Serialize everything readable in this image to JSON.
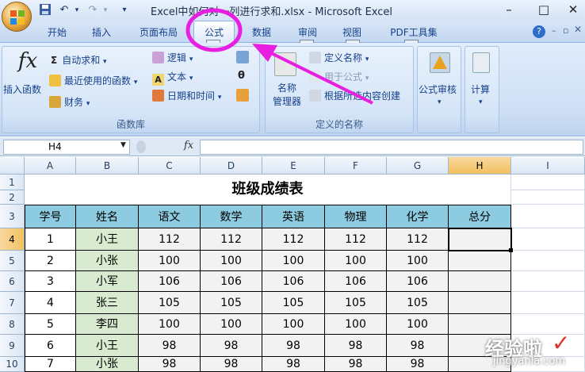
{
  "window": {
    "title": "Excel中如何对一列进行求和.xlsx - Microsoft Excel",
    "minimize": "–",
    "restore": "□",
    "close": "✕"
  },
  "quick_access": {
    "save": "save-icon",
    "undo": "undo-icon",
    "redo": "redo-icon",
    "customize": "customize-icon"
  },
  "tabs": [
    {
      "label": "开始"
    },
    {
      "label": "插入"
    },
    {
      "label": "页面布局"
    },
    {
      "label": "公式",
      "keytip": "M",
      "active": true
    },
    {
      "label": "数据",
      "keytip": "R"
    },
    {
      "label": "审阅",
      "keytip": "W"
    },
    {
      "label": "视图",
      "keytip": "Y"
    },
    {
      "label": "PDF工具集"
    }
  ],
  "ribbon": {
    "function_library": {
      "label": "函数库",
      "insert_function": "插入函数",
      "autosum": "自动求和",
      "recent": "最近使用的函数",
      "financial": "财务",
      "logical": "逻辑",
      "text": "文本",
      "datetime": "日期和时间"
    },
    "defined_names": {
      "label": "定义的名称",
      "name_manager": "名称管理器",
      "name_manager_line1": "名称",
      "name_manager_line2": "管理器",
      "define_name": "定义名称",
      "use_in_formula": "用于公式",
      "create_from_selection": "根据所选内容创建"
    },
    "formula_auditing": "公式审核",
    "calculation": "计算"
  },
  "formula_bar": {
    "name_box": "H4",
    "fx": "fx",
    "value": ""
  },
  "sheet": {
    "columns": [
      "A",
      "B",
      "C",
      "D",
      "E",
      "F",
      "G",
      "H",
      "I"
    ],
    "rows": [
      "1",
      "2",
      "3",
      "4",
      "5",
      "6",
      "7",
      "8",
      "9",
      "10"
    ],
    "selected_cell": "H4",
    "title": "班级成绩表",
    "headers": [
      "学号",
      "姓名",
      "语文",
      "数学",
      "英语",
      "物理",
      "化学",
      "总分"
    ],
    "data": [
      [
        "1",
        "小王",
        "112",
        "112",
        "112",
        "112",
        "112",
        ""
      ],
      [
        "2",
        "小张",
        "100",
        "100",
        "100",
        "100",
        "100",
        ""
      ],
      [
        "3",
        "小军",
        "106",
        "106",
        "106",
        "106",
        "106",
        ""
      ],
      [
        "4",
        "张三",
        "105",
        "105",
        "105",
        "105",
        "105",
        ""
      ],
      [
        "5",
        "李四",
        "100",
        "100",
        "100",
        "100",
        "100",
        ""
      ],
      [
        "6",
        "小王",
        "98",
        "98",
        "98",
        "98",
        "98",
        ""
      ],
      [
        "7",
        "小张",
        "98",
        "98",
        "98",
        "98",
        "98",
        ""
      ]
    ]
  },
  "watermark": {
    "text": "经验啦",
    "url": "jingyanla.com"
  },
  "colors": {
    "annotation": "#e81ee0",
    "header_fill": "#8dcce0",
    "name_fill": "#d8ead0"
  }
}
